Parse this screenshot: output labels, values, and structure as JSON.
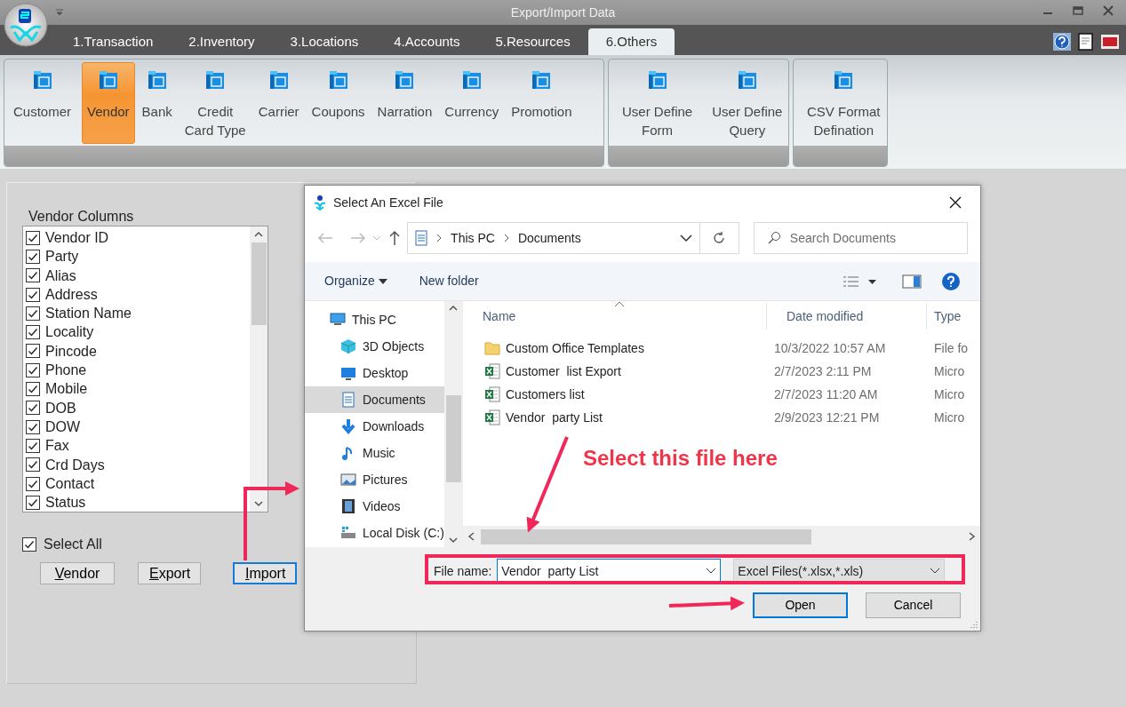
{
  "window": {
    "title": "Export/Import Data"
  },
  "menu_tabs": [
    {
      "label": "1.Transaction",
      "selected": false
    },
    {
      "label": "2.Inventory",
      "selected": false
    },
    {
      "label": "3.Locations",
      "selected": false
    },
    {
      "label": "4.Accounts",
      "selected": false
    },
    {
      "label": "5.Resources",
      "selected": false
    },
    {
      "label": "6.Others",
      "selected": true
    }
  ],
  "ribbon_groups": [
    {
      "buttons": [
        {
          "lines": [
            "Customer"
          ],
          "selected": false
        },
        {
          "lines": [
            "Vendor"
          ],
          "selected": true
        },
        {
          "lines": [
            "Bank"
          ],
          "selected": false
        },
        {
          "lines": [
            "Credit",
            "Card Type"
          ],
          "selected": false
        },
        {
          "lines": [
            "Carrier"
          ],
          "selected": false
        },
        {
          "lines": [
            "Coupons"
          ],
          "selected": false
        },
        {
          "lines": [
            "Narration"
          ],
          "selected": false
        },
        {
          "lines": [
            "Currency"
          ],
          "selected": false
        },
        {
          "lines": [
            "Promotion"
          ],
          "selected": false
        }
      ]
    },
    {
      "buttons": [
        {
          "lines": [
            "User Define",
            "Form"
          ],
          "selected": false
        },
        {
          "lines": [
            "User Define",
            "Query"
          ],
          "selected": false
        }
      ]
    },
    {
      "buttons": [
        {
          "lines": [
            "CSV Format",
            "Defination"
          ],
          "selected": false
        }
      ]
    }
  ],
  "vendor_columns": {
    "label": "Vendor Columns",
    "items": [
      {
        "label": "Vendor ID",
        "checked": true
      },
      {
        "label": "Party",
        "checked": true
      },
      {
        "label": "Alias",
        "checked": true
      },
      {
        "label": "Address",
        "checked": true
      },
      {
        "label": "Station Name",
        "checked": true
      },
      {
        "label": "Locality",
        "checked": true
      },
      {
        "label": "Pincode",
        "checked": true
      },
      {
        "label": "Phone",
        "checked": true
      },
      {
        "label": "Mobile",
        "checked": true
      },
      {
        "label": "DOB",
        "checked": true
      },
      {
        "label": "DOW",
        "checked": true
      },
      {
        "label": "Fax",
        "checked": true
      },
      {
        "label": "Crd Days",
        "checked": true
      },
      {
        "label": "Contact",
        "checked": true
      },
      {
        "label": "Status",
        "checked": true
      }
    ]
  },
  "select_all": {
    "label": "Select All",
    "checked": true
  },
  "actions": [
    {
      "label": "Vendor",
      "focused": false
    },
    {
      "label": "Export",
      "focused": false
    },
    {
      "label": "Import",
      "focused": true
    }
  ],
  "dialog": {
    "title": "Select An Excel File",
    "breadcrumb": [
      "This PC",
      "Documents"
    ],
    "search_placeholder": "Search Documents",
    "toolbar": [
      {
        "label": "Organize",
        "dropdown": true
      },
      {
        "label": "New folder",
        "dropdown": false
      }
    ],
    "nav": [
      {
        "label": "This PC",
        "kind": "pc",
        "selected": false,
        "children": [
          {
            "label": "3D Objects",
            "kind": "cube",
            "selected": false
          },
          {
            "label": "Desktop",
            "kind": "desktop",
            "selected": false
          },
          {
            "label": "Documents",
            "kind": "document",
            "selected": true
          },
          {
            "label": "Downloads",
            "kind": "download",
            "selected": false
          },
          {
            "label": "Music",
            "kind": "music",
            "selected": false
          },
          {
            "label": "Pictures",
            "kind": "pictures",
            "selected": false
          },
          {
            "label": "Videos",
            "kind": "videos",
            "selected": false
          },
          {
            "label": "Local Disk (C:)",
            "kind": "disk",
            "selected": false
          }
        ]
      }
    ],
    "columns": [
      "Name",
      "Date modified",
      "Type"
    ],
    "files": [
      {
        "name": "Custom Office Templates",
        "kind": "folder",
        "date": "10/3/2022 10:57 AM",
        "type": "File fo"
      },
      {
        "name": "Customer  list Export",
        "kind": "excel",
        "date": "2/7/2023 2:11 PM",
        "type": "Micro"
      },
      {
        "name": "Customers list",
        "kind": "excel",
        "date": "2/7/2023 11:20 AM",
        "type": "Micro"
      },
      {
        "name": "Vendor  party List",
        "kind": "excel",
        "date": "2/9/2023 12:21 PM",
        "type": "Micro"
      }
    ],
    "file_name": {
      "label": "File name:",
      "value": "Vendor  party List"
    },
    "file_type": "Excel Files(*.xlsx,*.xls)",
    "buttons": [
      {
        "label": "Open",
        "focused": true
      },
      {
        "label": "Cancel",
        "focused": false
      }
    ]
  },
  "annotations": [
    {
      "text": "Select this file here"
    }
  ]
}
